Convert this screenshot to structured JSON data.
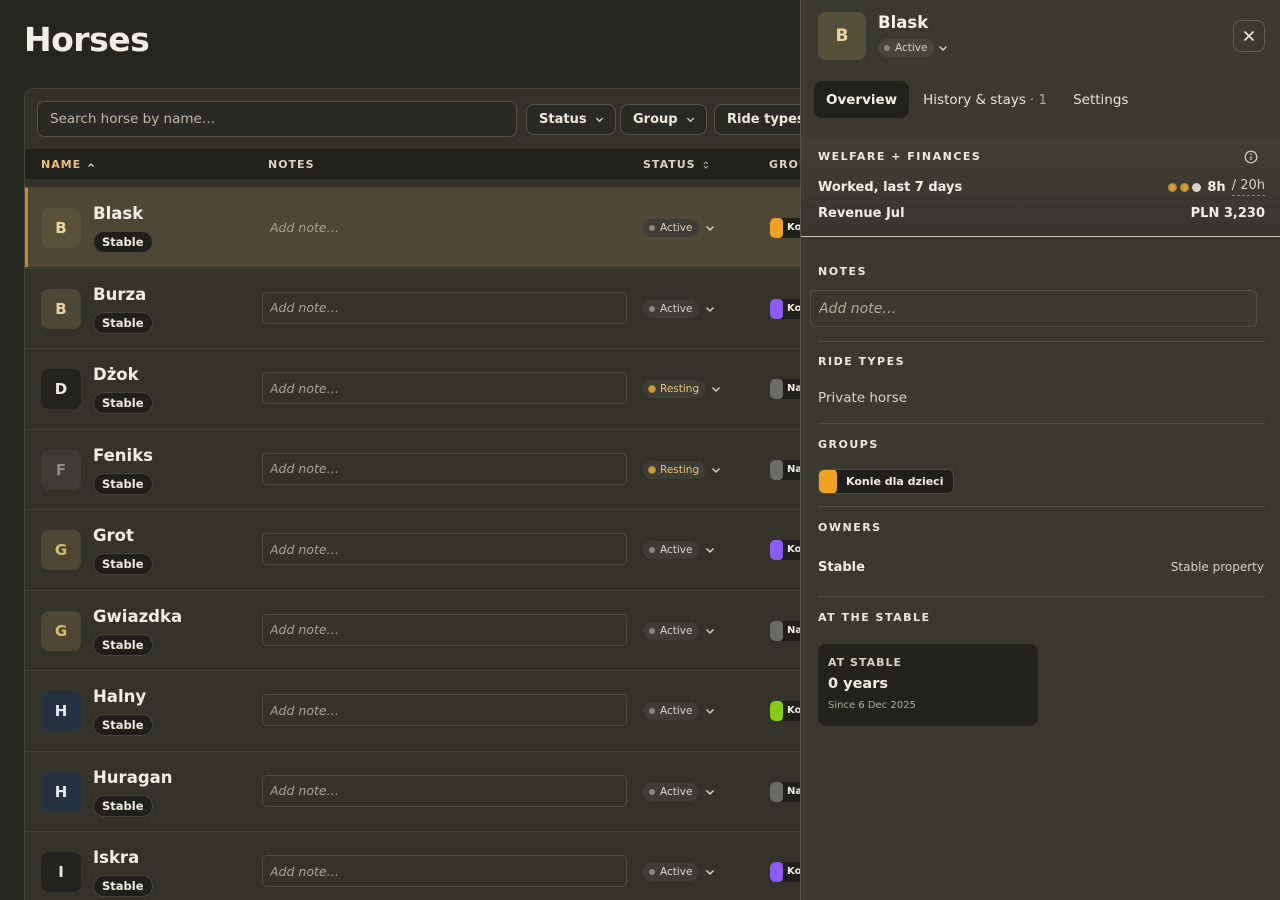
{
  "page": {
    "title": "Horses"
  },
  "toolbar": {
    "search_placeholder": "Search horse by name…",
    "filters": [
      "Status",
      "Group",
      "Ride types"
    ]
  },
  "table": {
    "columns": {
      "name": "NAME",
      "notes": "NOTES",
      "status": "STATUS",
      "group": "GROU"
    },
    "note_placeholder": "Add note…",
    "rows": [
      {
        "initial": "B",
        "name": "Blask",
        "owner": "Stable",
        "status": "Active",
        "group_abbr": "Ko",
        "group_color": "#f0a223",
        "avatar_bg": "#5a5238",
        "avatar_fg": "#e9d49f",
        "selected": true
      },
      {
        "initial": "B",
        "name": "Burza",
        "owner": "Stable",
        "status": "Active",
        "group_abbr": "Ko",
        "group_color": "#8b5cf6",
        "avatar_bg": "#4c4835",
        "avatar_fg": "#e9d49f"
      },
      {
        "initial": "D",
        "name": "Dżok",
        "owner": "Stable",
        "status": "Resting",
        "group_abbr": "Na",
        "group_color": "#6b6b66",
        "avatar_bg": "#23231f",
        "avatar_fg": "#ece9df"
      },
      {
        "initial": "F",
        "name": "Feniks",
        "owner": "Stable",
        "status": "Resting",
        "group_abbr": "Na",
        "group_color": "#6b6b66",
        "avatar_bg": "#3c3c35",
        "avatar_fg": "#8e8b80"
      },
      {
        "initial": "G",
        "name": "Grot",
        "owner": "Stable",
        "status": "Active",
        "group_abbr": "Ko",
        "group_color": "#8b5cf6",
        "avatar_bg": "#4c4835",
        "avatar_fg": "#d9b96e"
      },
      {
        "initial": "G",
        "name": "Gwiazdka",
        "owner": "Stable",
        "status": "Active",
        "group_abbr": "Na",
        "group_color": "#6b6b66",
        "avatar_bg": "#4c4835",
        "avatar_fg": "#d9b96e"
      },
      {
        "initial": "H",
        "name": "Halny",
        "owner": "Stable",
        "status": "Active",
        "group_abbr": "Ko",
        "group_color": "#84cc16",
        "avatar_bg": "#253242",
        "avatar_fg": "#e6e9ef"
      },
      {
        "initial": "H",
        "name": "Huragan",
        "owner": "Stable",
        "status": "Active",
        "group_abbr": "Na",
        "group_color": "#6b6b66",
        "avatar_bg": "#253242",
        "avatar_fg": "#e6e9ef"
      },
      {
        "initial": "I",
        "name": "Iskra",
        "owner": "Stable",
        "status": "Active",
        "group_abbr": "Ko",
        "group_color": "#8b5cf6",
        "avatar_bg": "#23231f",
        "avatar_fg": "#ece9df"
      }
    ]
  },
  "panel": {
    "initial": "B",
    "name": "Blask",
    "status": "Active",
    "tabs": {
      "overview": "Overview",
      "history": "History & stays",
      "history_count": "· 1",
      "settings": "Settings"
    },
    "welfare": {
      "title": "WELFARE + FINANCES",
      "worked_label": "Worked, last 7 days",
      "worked_hours": "8h",
      "worked_target": "/ 20h",
      "worked_level": 0.4,
      "revenue_label": "Revenue Jul",
      "revenue_value": "PLN 3,230"
    },
    "notes": {
      "title": "NOTES",
      "placeholder": "Add note…"
    },
    "ride_types": {
      "title": "RIDE TYPES",
      "value": "Private horse"
    },
    "groups": {
      "title": "GROUPS",
      "items": [
        {
          "name": "Konie dla dzieci",
          "color": "#f0a223"
        }
      ]
    },
    "owners": {
      "title": "OWNERS",
      "name": "Stable",
      "type": "Stable property"
    },
    "at_stable": {
      "title": "AT THE STABLE",
      "card_label": "AT STABLE",
      "duration": "0 years",
      "since": "Since 6 Dec 2025"
    }
  },
  "colors": {
    "accent": "#e6c07a",
    "selected_border": "#c08a25",
    "resting": "#d29a3a"
  },
  "icons": [
    "chevron-down-icon",
    "sort-asc-icon",
    "sort-icon",
    "close-icon",
    "info-icon"
  ]
}
